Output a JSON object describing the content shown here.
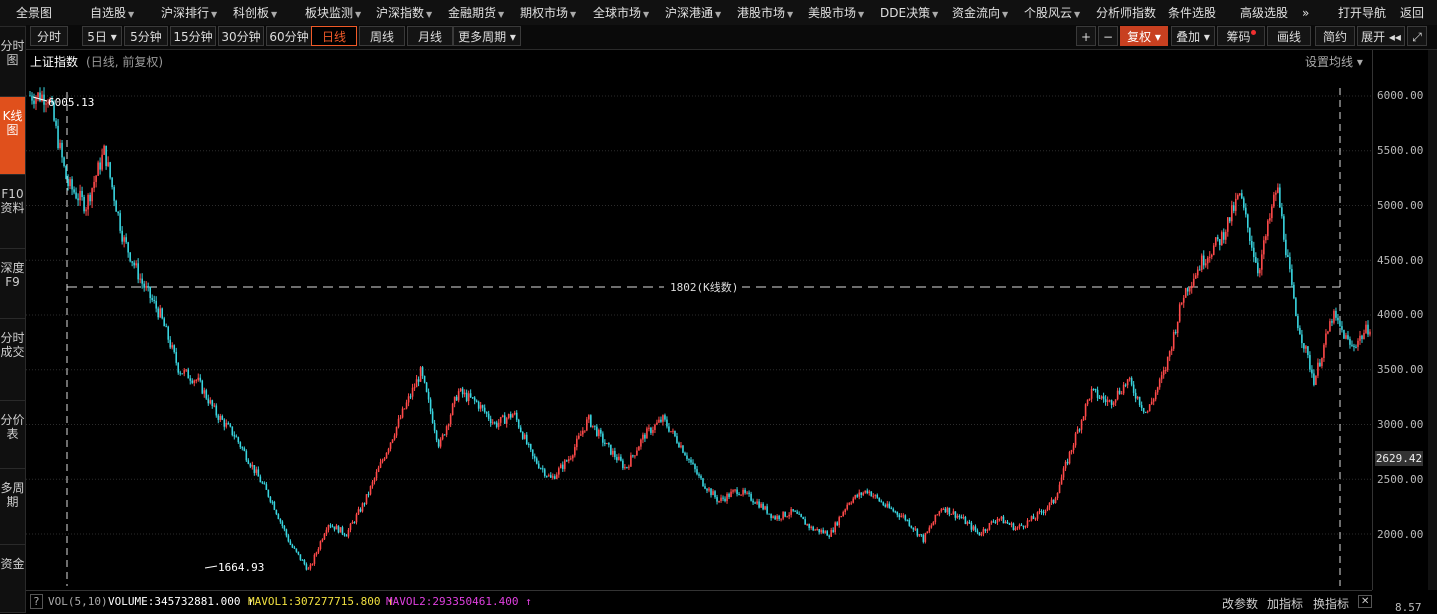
{
  "top_menu": [
    {
      "label": "全景图",
      "arrow": false
    },
    {
      "label": "自选股",
      "arrow": true
    },
    {
      "label": "沪深排行",
      "arrow": true
    },
    {
      "label": "科创板",
      "arrow": true
    },
    {
      "label": "板块监测",
      "arrow": true
    },
    {
      "label": "沪深指数",
      "arrow": true
    },
    {
      "label": "金融期货",
      "arrow": true
    },
    {
      "label": "期权市场",
      "arrow": true
    },
    {
      "label": "全球市场",
      "arrow": true
    },
    {
      "label": "沪深港通",
      "arrow": true
    },
    {
      "label": "港股市场",
      "arrow": true
    },
    {
      "label": "美股市场",
      "arrow": true
    },
    {
      "label": "DDE决策",
      "arrow": true
    },
    {
      "label": "资金流向",
      "arrow": true
    },
    {
      "label": "个股风云",
      "arrow": true
    },
    {
      "label": "分析师指数",
      "arrow": false
    },
    {
      "label": "条件选股",
      "arrow": false
    },
    {
      "label": "高级选股",
      "arrow": false
    },
    {
      "label": "»",
      "arrow": false
    },
    {
      "label": "打开导航",
      "arrow": false
    },
    {
      "label": "返回",
      "arrow": false
    }
  ],
  "left_nav": [
    "分时图",
    "K线图",
    "F10资料",
    "深度F9",
    "分时成交",
    "分价表",
    "多周期",
    "资金"
  ],
  "period_tabs": [
    "分时",
    "5日 ▾",
    "5分钟",
    "15分钟",
    "30分钟",
    "60分钟",
    "日线",
    "周线",
    "月线",
    "更多周期 ▾"
  ],
  "right_tools": {
    "zoom_in": "+",
    "zoom_out": "−",
    "fuquan": "复权 ▾",
    "overlay": "叠加 ▾",
    "chips": "筹码",
    "draw": "画线",
    "simple": "简约",
    "expand": "展开 ◂◂",
    "fullscreen": "⤢"
  },
  "chart_header": {
    "name": "上证指数",
    "sub": "(日线, 前复权)",
    "set_ma": "设置均线 ▾"
  },
  "y_axis": [
    "6000.00",
    "5500.00",
    "5000.00",
    "4500.00",
    "4000.00",
    "3500.00",
    "3000.00",
    "2500.00",
    "2000.00"
  ],
  "current_price": "2629.42",
  "annotations": {
    "high": "6005.13",
    "low": "1664.93",
    "measure": "1802(K线数)"
  },
  "volume_bar": {
    "q": "?",
    "vol": "VOL(5,10)",
    "volume": "VOLUME:345732881.000 ↑",
    "mavol1": "MAVOL1:307277715.800 ↑",
    "mavol2": "MAVOL2:293350461.400 ↑",
    "params": "改参数",
    "add": "加指标",
    "swap": "换指标",
    "close": "✕",
    "sub_axis": "8.57"
  },
  "colors": {
    "up": "#ff4a4a",
    "down": "#39d5e0",
    "accent": "#e0501c"
  },
  "chart_data": {
    "type": "candlestick",
    "x_label": "",
    "y_label": "",
    "ylim": [
      1664.93,
      6005.13
    ],
    "keypoints": [
      6005.13,
      6000,
      5200,
      5000,
      5500,
      4700,
      4300,
      4000,
      3500,
      3400,
      3100,
      2900,
      2600,
      2300,
      1900,
      1664.93,
      2100,
      2000,
      2300,
      2700,
      3100,
      3478,
      2800,
      3300,
      3200,
      3000,
      3100,
      2700,
      2500,
      2700,
      3050,
      2800,
      2600,
      2900,
      3050,
      2800,
      2500,
      2300,
      2400,
      2300,
      2150,
      2200,
      2050,
      2000,
      2300,
      2400,
      2250,
      2150,
      1950,
      2250,
      2150,
      2000,
      2150,
      2050,
      2150,
      2300,
      2800,
      3300,
      3200,
      3400,
      3100,
      3500,
      4200,
      4500,
      4700,
      5100,
      4400,
      5178,
      4000,
      3400,
      4000,
      3700,
      3900
    ]
  }
}
